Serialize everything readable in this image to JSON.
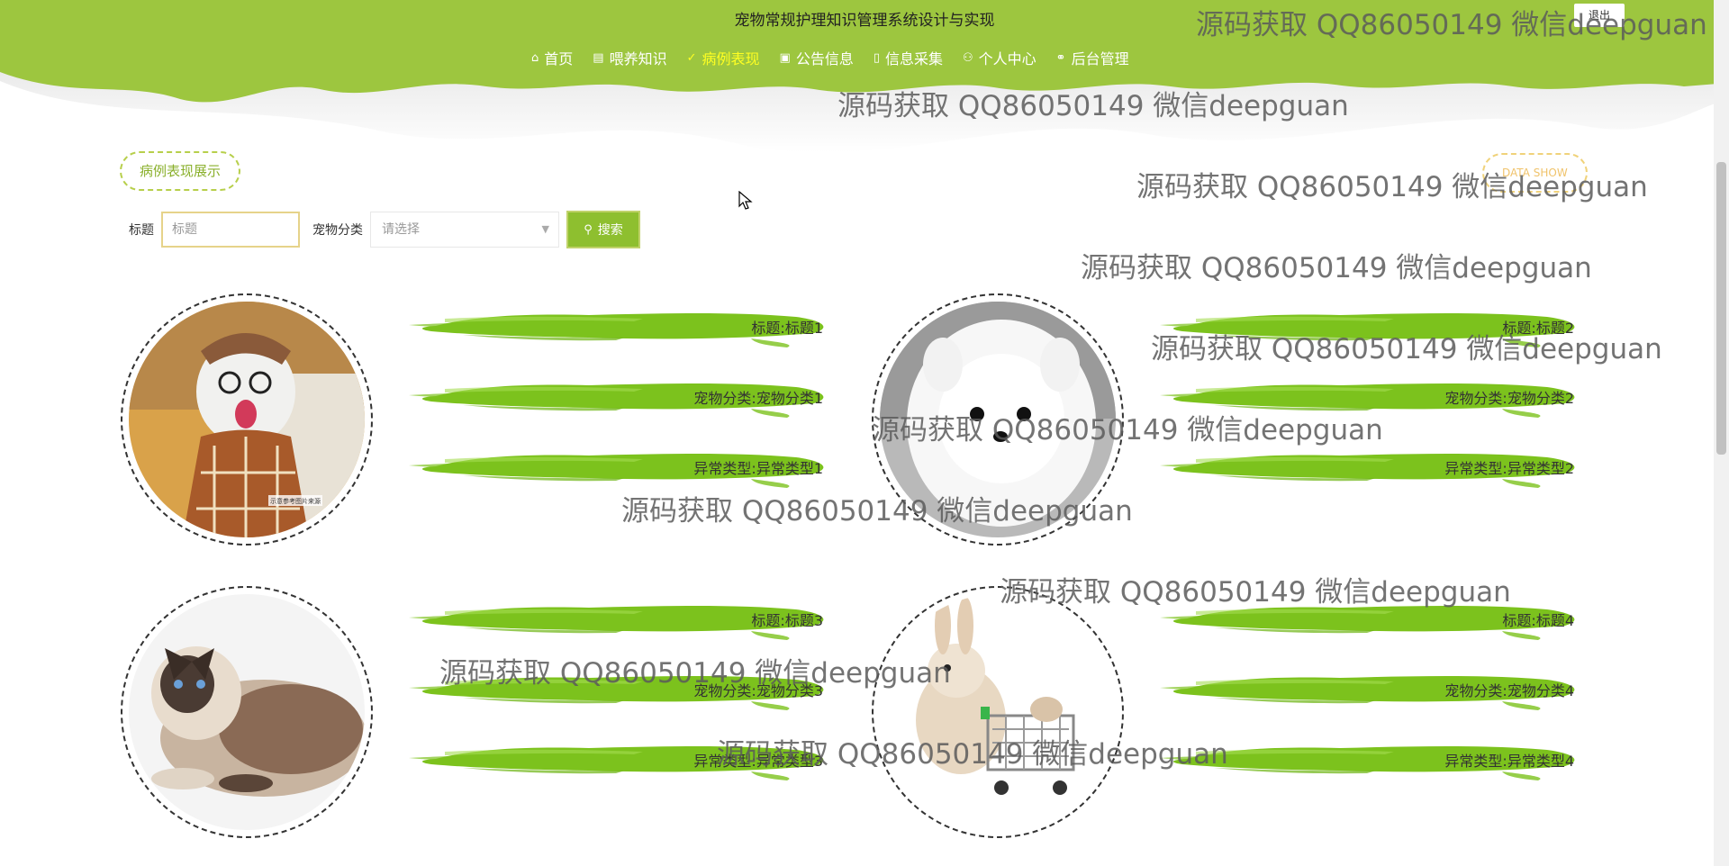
{
  "header": {
    "site_title": "宠物常规护理知识管理系统设计与实现",
    "logout_label": "退出",
    "nav": [
      {
        "icon": "home-icon",
        "label": "首页"
      },
      {
        "icon": "book-icon",
        "label": "喂养知识"
      },
      {
        "icon": "check-icon",
        "label": "病例表现",
        "active": true
      },
      {
        "icon": "clipboard-icon",
        "label": "公告信息"
      },
      {
        "icon": "document-icon",
        "label": "信息采集"
      },
      {
        "icon": "user-icon",
        "label": "个人中心"
      },
      {
        "icon": "link-icon",
        "label": "后台管理"
      }
    ],
    "colors": {
      "primary": "#9dc63f",
      "active": "#ffff22"
    }
  },
  "section": {
    "title": "病例表现展示",
    "subtitle": "DATA SHOW"
  },
  "search": {
    "title_label": "标题",
    "title_placeholder": "标题",
    "category_label": "宠物分类",
    "category_placeholder": "请选择",
    "button_label": "搜索"
  },
  "cards": [
    {
      "title": "标题:标题1",
      "category": "宠物分类:宠物分类1",
      "anomaly": "异常类型:异常类型1",
      "image": "dog with glasses and plaid shirt",
      "photo_caption": "示意参考图片来源"
    },
    {
      "title": "标题:标题2",
      "category": "宠物分类:宠物分类2",
      "anomaly": "异常类型:异常类型2",
      "image": "white pomeranian puppy"
    },
    {
      "title": "标题:标题3",
      "category": "宠物分类:宠物分类3",
      "anomaly": "异常类型:异常类型3",
      "image": "ragdoll cat lying"
    },
    {
      "title": "标题:标题4",
      "category": "宠物分类:宠物分类4",
      "anomaly": "异常类型:异常类型4",
      "image": "rabbit with shopping cart"
    }
  ],
  "watermark": "源码获取 QQ86050149 微信deepguan"
}
